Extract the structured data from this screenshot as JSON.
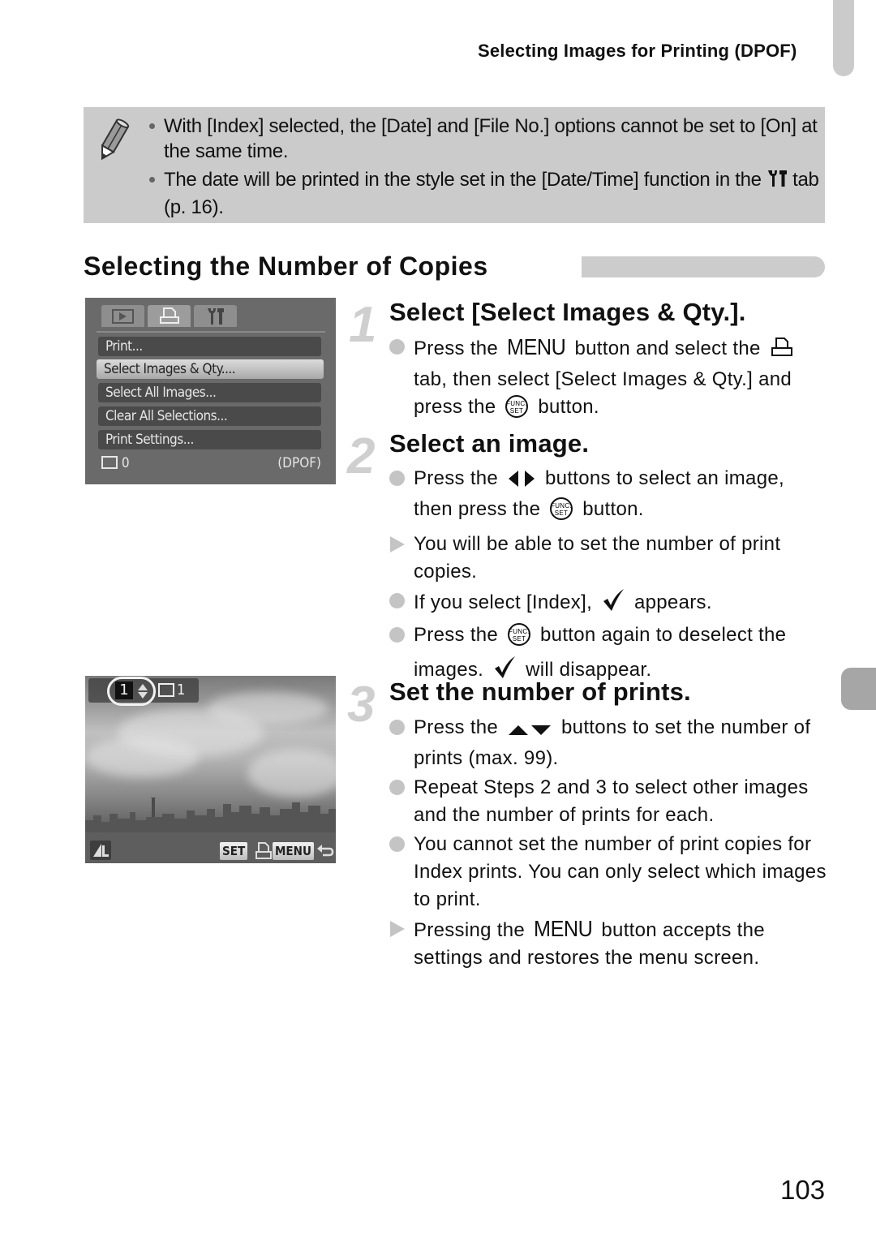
{
  "header": {
    "running_title": "Selecting Images for Printing (DPOF)"
  },
  "note": {
    "icon": "pencil-icon",
    "items": [
      "With [Index] selected, the [Date] and [File No.] options cannot be set to [On] at the same time.",
      "The date will be printed in the style set in the [Date/Time] function in the"
    ],
    "item2_tail": "tab (p. 16).",
    "item2_icon": "settings-wrench-icon"
  },
  "section": {
    "title": "Selecting the Number of Copies"
  },
  "steps": [
    {
      "number": "1",
      "title": "Select [Select Images & Qty.].",
      "p1_a": "Press the",
      "p1_menu": "MENU",
      "p1_b": "button and select the",
      "p1_c": "tab, then select [Select Images & Qty.] and press the",
      "p1_d": "button."
    },
    {
      "number": "2",
      "title": "Select an image.",
      "b1_a": "Press the",
      "b1_b": "buttons to select an image, then press the",
      "b1_c": "button.",
      "b2": "You will be able to set the number of print copies.",
      "b3_a": "If you select [Index],",
      "b3_b": "appears.",
      "b4_a": "Press the",
      "b4_b": "button again to deselect the images.",
      "b4_c": "will disappear."
    },
    {
      "number": "3",
      "title": "Set the number of prints.",
      "b1_a": "Press the",
      "b1_b": "buttons to set the number of prints (max. 99).",
      "b2": "Repeat Steps 2 and 3 to select other images and the number of prints for each.",
      "b3": "You cannot set the number of print copies for Index prints. You can only select which images to print.",
      "b4_a": "Pressing the",
      "b4_menu": "MENU",
      "b4_b": "button accepts the settings and restores the menu screen."
    }
  ],
  "func_set_icon": {
    "line1": "FUNC.",
    "line2": "SET"
  },
  "screen_menu": {
    "tabs": [
      "playback-tab-icon",
      "print-tab-icon",
      "settings-tab-icon"
    ],
    "active_tab": 1,
    "items": [
      "Print...",
      "Select Images & Qty....",
      "Select All Images...",
      "Clear All Selections...",
      "Print Settings..."
    ],
    "selected_index": 1,
    "status_count": "0",
    "status_mode": "(DPOF)"
  },
  "screen_qty": {
    "copies": "1",
    "total": "1",
    "set_label": "SET",
    "menu_label": "MENU"
  },
  "page_number": "103"
}
